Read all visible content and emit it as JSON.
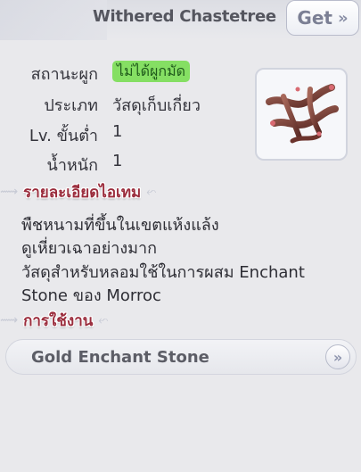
{
  "header": {
    "title": "Withered Chastetree",
    "get_label": "Get",
    "get_arrow": "»"
  },
  "info": {
    "status_label": "สถานะผูก",
    "status_value": "ไม่ได้ผูกมัด",
    "type_label": "ประเภท",
    "type_value": "วัสดุเก็บเกี่ยว",
    "level_label": "Lv. ขั้นต่ำ",
    "level_value": "1",
    "weight_label": "น้ำหนัก",
    "weight_value": "1"
  },
  "details": {
    "title": "รายละเอียดไอเทม",
    "lines": [
      "พืชหนามที่ขึ้นในเขตแห้งแล้ง",
      "ดูเหี่ยวเฉาอย่างมาก",
      "วัสดุสำหรับหลอมใช้ในการผสม Enchant",
      "Stone ของ Morroc"
    ]
  },
  "usage": {
    "title": "การใช้งาน",
    "items": [
      {
        "label": "Gold Enchant Stone",
        "arrow": "»"
      }
    ]
  },
  "icons": {
    "item": "withered-branch-icon",
    "wing": "wing-ornament-icon"
  },
  "colors": {
    "badge_bg": "#85df63",
    "section_title": "#9b2d3d",
    "background": "#e9e9ec"
  }
}
